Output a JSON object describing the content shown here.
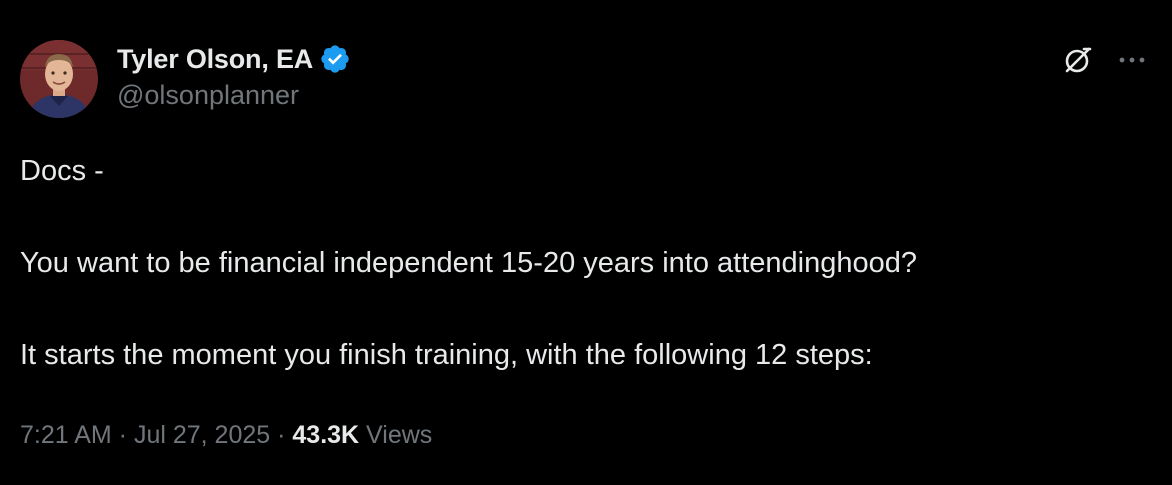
{
  "author": {
    "display_name": "Tyler Olson, EA",
    "handle": "@olsonplanner",
    "verified_color": "#1d9bf0"
  },
  "icons": {
    "verified": "verified-badge-icon",
    "grok": "grok-icon",
    "more": "more-options-icon"
  },
  "tweet": {
    "lines": [
      "Docs -",
      "You want to be financial independent 15-20 years into attendinghood?",
      "It starts the moment you finish training, with the following 12 steps:"
    ]
  },
  "meta": {
    "time": "7:21 AM",
    "separator_1": " · ",
    "date": "Jul 27, 2025",
    "separator_2": " · ",
    "views_count": "43.3K",
    "views_label": " Views"
  },
  "colors": {
    "background": "#000000",
    "primary_text": "#e7e9ea",
    "secondary_text": "#71767b",
    "accent": "#1d9bf0"
  }
}
